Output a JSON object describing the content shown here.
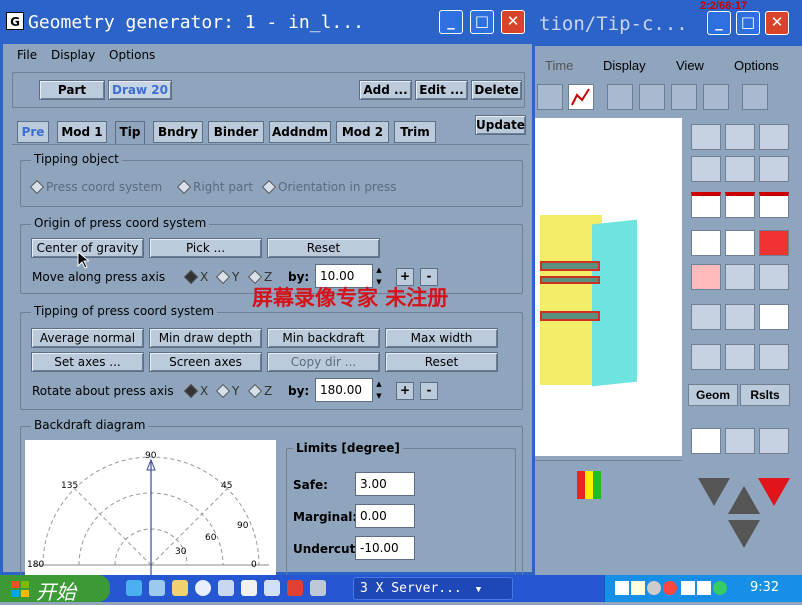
{
  "background_window": {
    "title": "tion/Tip-c...",
    "frame_counter": "2:2/68:17",
    "menu": [
      "Time",
      "Display",
      "View",
      "Options"
    ],
    "tabs": [
      "Geom",
      "Rslts"
    ]
  },
  "main_window": {
    "title": "Geometry generator: 1  -  in_l...",
    "menu": [
      "File",
      "Display",
      "Options"
    ],
    "part_label": "Part",
    "draw_value": "Draw 20",
    "add_button": "Add ...",
    "edit_button": "Edit ...",
    "delete_button": "Delete",
    "tabs": [
      "Pre",
      "Mod 1",
      "Tip",
      "Bndry",
      "Binder",
      "Addndm",
      "Mod 2",
      "Trim"
    ],
    "selected_tab": "Tip",
    "update_button": "Update",
    "tipping_object": {
      "title": "Tipping object",
      "options": [
        "Press coord system",
        "Right part",
        "Orientation in press"
      ]
    },
    "origin": {
      "title": "Origin of press coord system",
      "center_button": "Center of gravity",
      "pick_button": "Pick ...",
      "reset_button": "Reset",
      "move_label": "Move along press axis",
      "axes": [
        "X",
        "Y",
        "Z"
      ],
      "by_label": "by:",
      "value": "10.00",
      "plus": "+",
      "minus": "-"
    },
    "tipping": {
      "title": "Tipping of press coord system",
      "buttons": [
        "Average normal",
        "Min draw depth",
        "Min backdraft",
        "Max width",
        "Set axes ...",
        "Screen axes",
        "Copy dir ...",
        "Reset"
      ],
      "rotate_label": "Rotate about press axis",
      "axes": [
        "X",
        "Y",
        "Z"
      ],
      "by_label": "by:",
      "value": "180.00",
      "plus": "+",
      "minus": "-"
    },
    "backdraft": {
      "title": "Backdraft diagram",
      "limits_title": "Limits [degree]",
      "safe_label": "Safe:",
      "safe_value": "3.00",
      "marginal_label": "Marginal:",
      "marginal_value": "0.00",
      "undercut_label": "Undercut:",
      "undercut_value": "-10.00"
    }
  },
  "chart_data": {
    "type": "polar",
    "angle_labels": [
      "90",
      "135",
      "45",
      "180",
      "0"
    ],
    "radius_labels": [
      "30",
      "60",
      "90"
    ]
  },
  "watermark": "屏幕录像专家  未注册",
  "taskbar": {
    "start_label": "开始",
    "task_item": "3 X Server...",
    "clock": "9:32"
  },
  "colors": {
    "titlebar": "#2b63c8",
    "window_bg": "#8fa4bd",
    "accent_link": "#3d6fd0",
    "watermark": "#d4141a"
  }
}
